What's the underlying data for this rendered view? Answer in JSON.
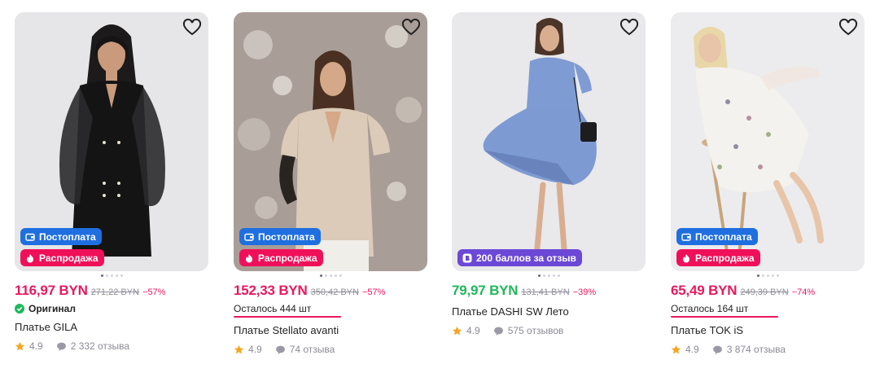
{
  "icons": {
    "favorite": "heart-outline-icon",
    "postpay": "wallet-icon",
    "sale": "flame-icon",
    "bonus": "bonus-b-icon",
    "original": "check-circle-icon",
    "rating": "star-icon",
    "reviews": "speech-bubble-icon"
  },
  "colors": {
    "price_pink": "#e8185f",
    "price_green": "#1fb85a",
    "badge_blue": "#1f6fe0",
    "badge_red": "#f0105a",
    "badge_violet": "#6b48d6",
    "star": "#f5a623"
  },
  "products": [
    {
      "badges": [
        "Постоплата",
        "Распродажа"
      ],
      "price": "116,97 BYN",
      "old_price": "271,22 BYN",
      "discount": "−57%",
      "original_label": "Оригинал",
      "title": "Платье GILA",
      "rating": "4.9",
      "reviews": "2 332 отзыва"
    },
    {
      "badges": [
        "Постоплата",
        "Распродажа"
      ],
      "price": "152,33 BYN",
      "old_price": "350,42 BYN",
      "discount": "−57%",
      "stock": "Осталось 444 шт",
      "title": "Платье Stellato avanti",
      "rating": "4.9",
      "reviews": "74 отзыва"
    },
    {
      "badges": [
        "200 баллов за отзыв"
      ],
      "price": "79,97 BYN",
      "old_price": "131,41 BYN",
      "discount": "−39%",
      "title": "Платье DASHI SW Лето",
      "rating": "4.9",
      "reviews": "575 отзывов"
    },
    {
      "badges": [
        "Постоплата",
        "Распродажа"
      ],
      "price": "65,49 BYN",
      "old_price": "249,39 BYN",
      "discount": "−74%",
      "stock": "Осталось 164 шт",
      "title": "Платье TOK iS",
      "rating": "4.9",
      "reviews": "3 874 отзыва"
    }
  ]
}
